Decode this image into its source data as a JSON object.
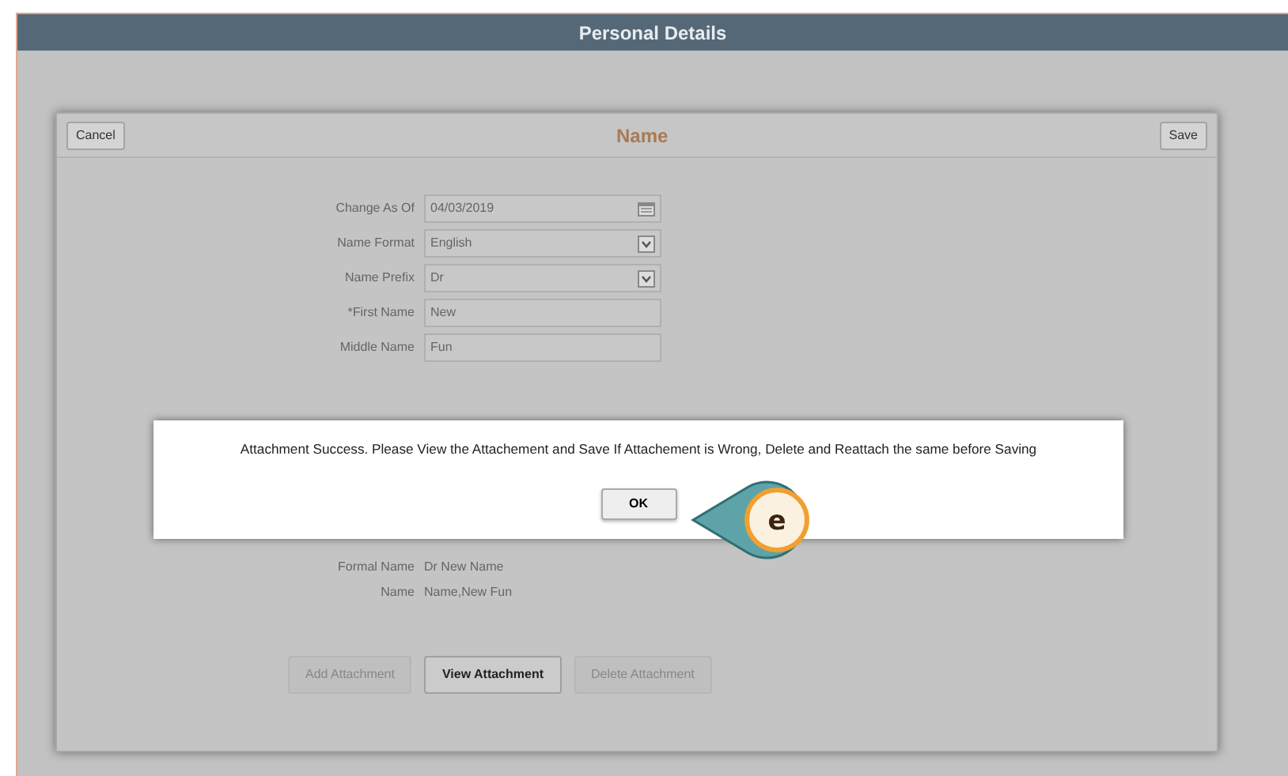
{
  "header": {
    "title": "Personal Details"
  },
  "modal": {
    "title": "Name",
    "cancel": "Cancel",
    "save": "Save",
    "fields": [
      {
        "label": "Change As Of",
        "value": "04/03/2019",
        "kind": "date"
      },
      {
        "label": "Name Format",
        "value": "English",
        "kind": "select"
      },
      {
        "label": "Name Prefix",
        "value": "Dr",
        "kind": "select"
      },
      {
        "label": "*First Name",
        "value": "New",
        "kind": "text"
      },
      {
        "label": "Middle Name",
        "value": "Fun",
        "kind": "text"
      }
    ],
    "display_fields": [
      {
        "label": "Formal Name",
        "value": "Dr New Name"
      },
      {
        "label": "Name",
        "value": "Name,New Fun"
      }
    ],
    "buttons": [
      {
        "label": "Add Attachment",
        "disabled": true
      },
      {
        "label": "View Attachment",
        "disabled": false
      },
      {
        "label": "Delete Attachment",
        "disabled": true
      }
    ]
  },
  "alert": {
    "message": "Attachment Success. Please View the Attachement and Save  If Attachement is Wrong, Delete and Reattach the same before Saving",
    "button": "OK"
  },
  "callout": {
    "label": "e"
  }
}
